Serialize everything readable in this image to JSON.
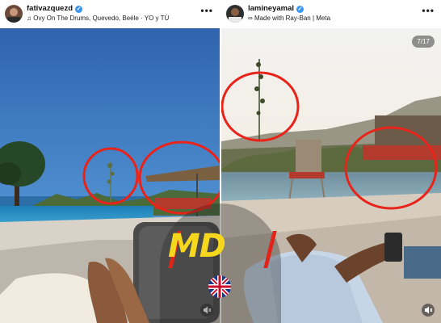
{
  "left_post": {
    "username": "fativazquezd",
    "audio": "Ovy On The Drums, Quevedo, Beéle · YO y TÚ",
    "audio_icon": "music-note-icon",
    "menu_icon": "more-dots-icon"
  },
  "right_post": {
    "username": "lamineyamal",
    "subtitle": "Made with Ray-Ban | Meta",
    "subtitle_icon": "glasses-icon",
    "menu_icon": "more-dots-icon",
    "counter": "7/17"
  },
  "watermark": {
    "text": "MD",
    "colors": {
      "letters": "#f5d71d",
      "bars": "#e2231a"
    }
  },
  "colors": {
    "verified": "#3897f0",
    "highlight_circle": "#e8231a"
  }
}
